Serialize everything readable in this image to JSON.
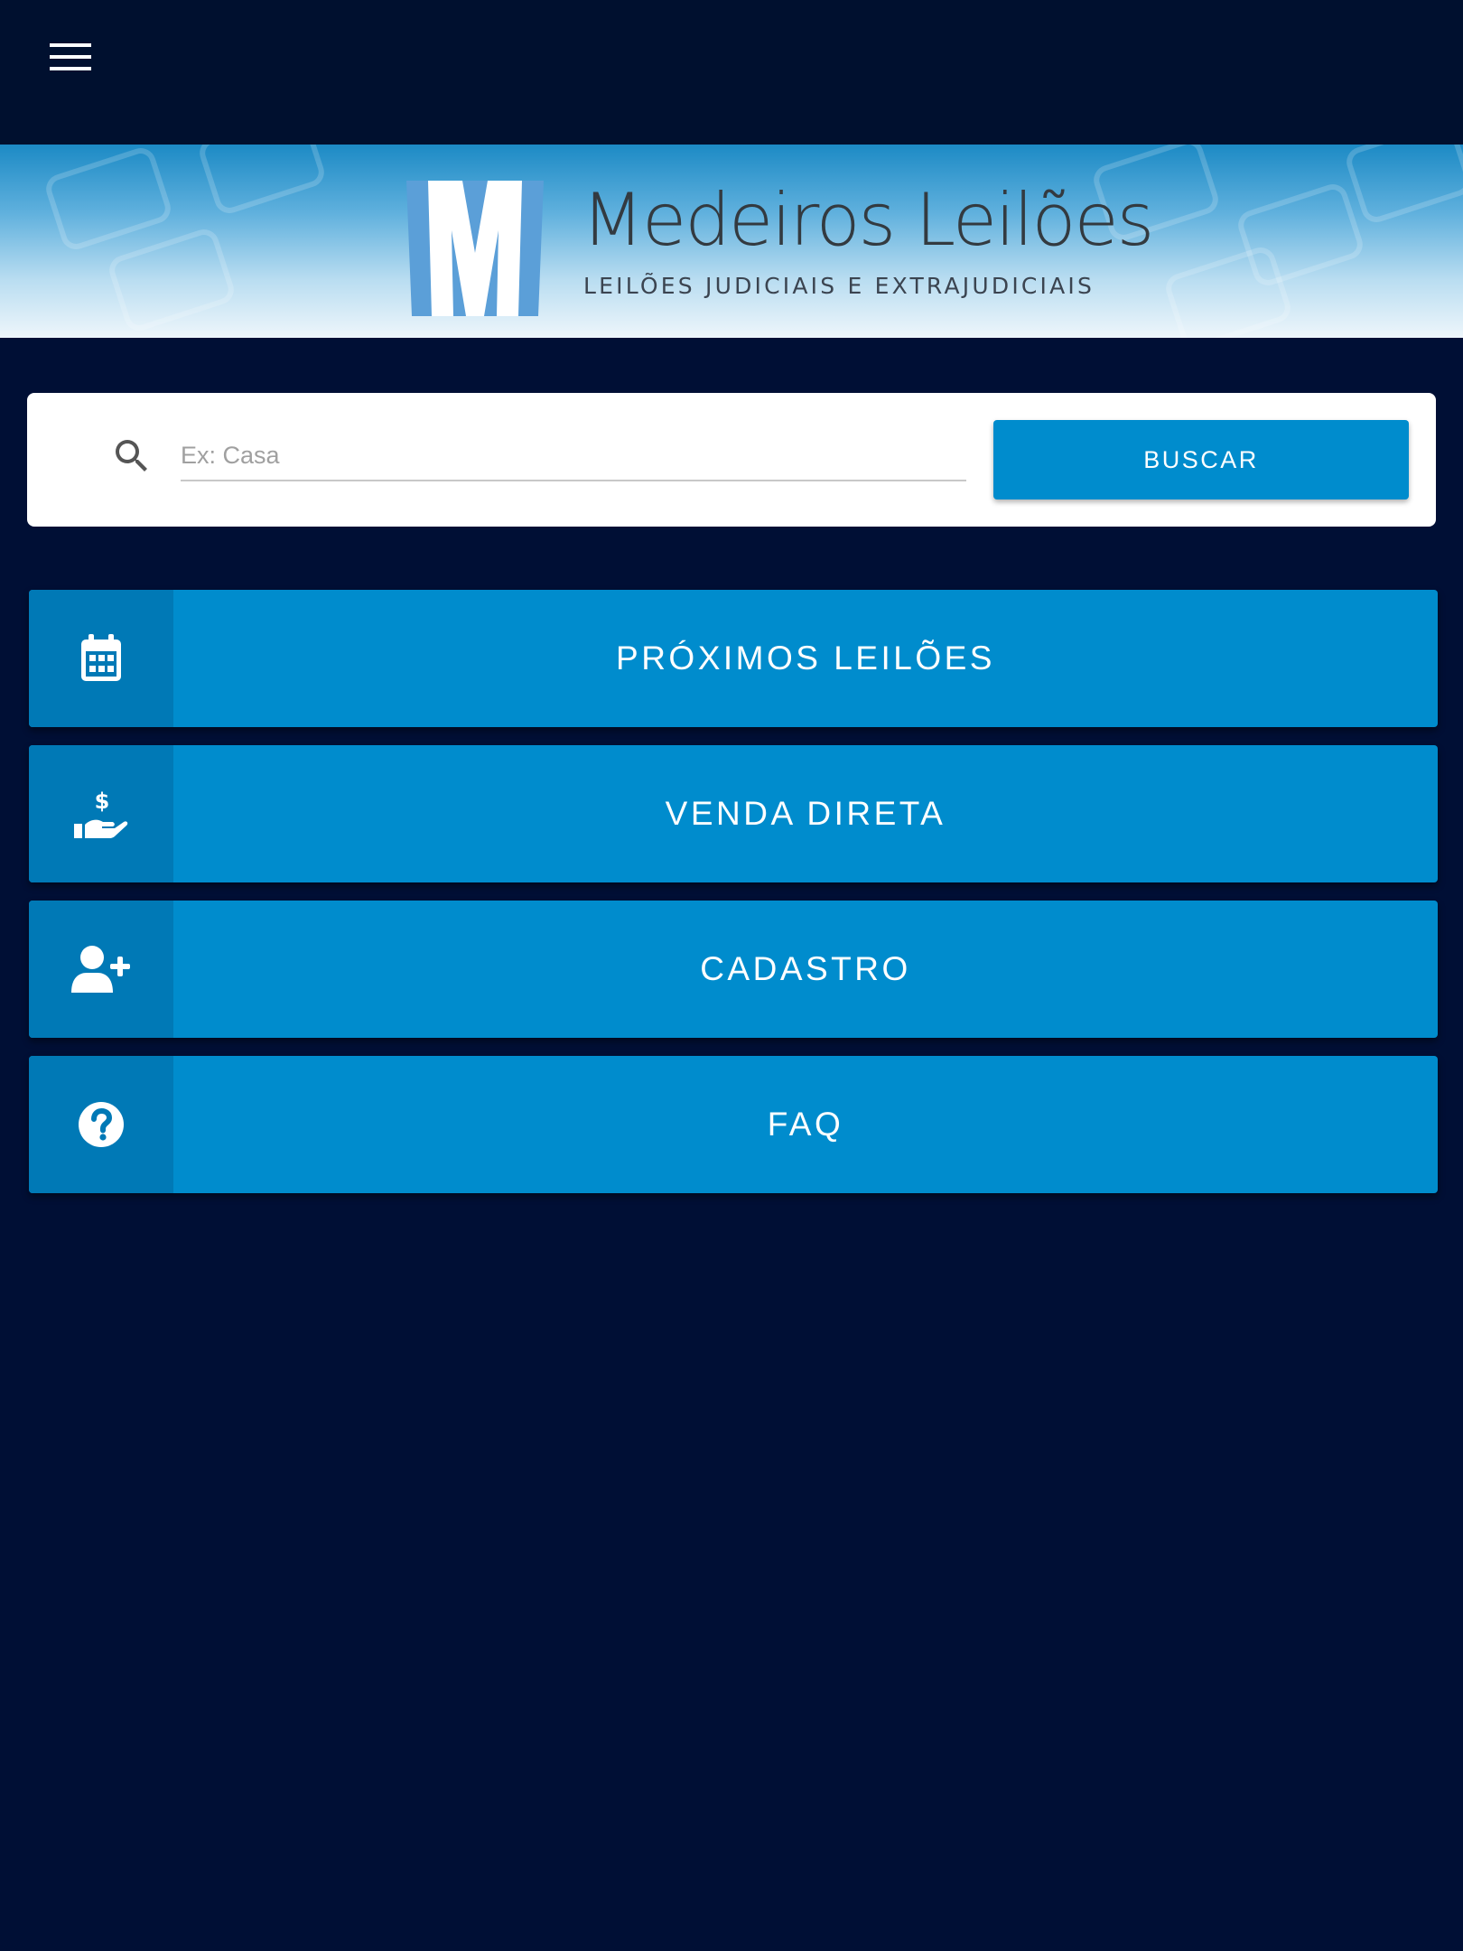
{
  "header": {
    "menu_icon": "hamburger-menu-icon"
  },
  "banner": {
    "brand_name": "Medeiros Leilões",
    "tagline": "LEILÕES JUDICIAIS E EXTRAJUDICIAIS"
  },
  "search": {
    "icon": "search-icon",
    "placeholder": "Ex: Casa",
    "value": "",
    "button_label": "BUSCAR"
  },
  "nav": {
    "items": [
      {
        "label": "PRÓXIMOS LEILÕES",
        "icon": "calendar-icon"
      },
      {
        "label": "VENDA DIRETA",
        "icon": "hand-money-icon"
      },
      {
        "label": "CADASTRO",
        "icon": "user-plus-icon"
      },
      {
        "label": "FAQ",
        "icon": "question-circle-icon"
      }
    ]
  },
  "colors": {
    "background": "#000f35",
    "topbar": "#00102f",
    "accent": "#008ccd",
    "accent_dark": "#0079b6",
    "card": "#ffffff"
  }
}
